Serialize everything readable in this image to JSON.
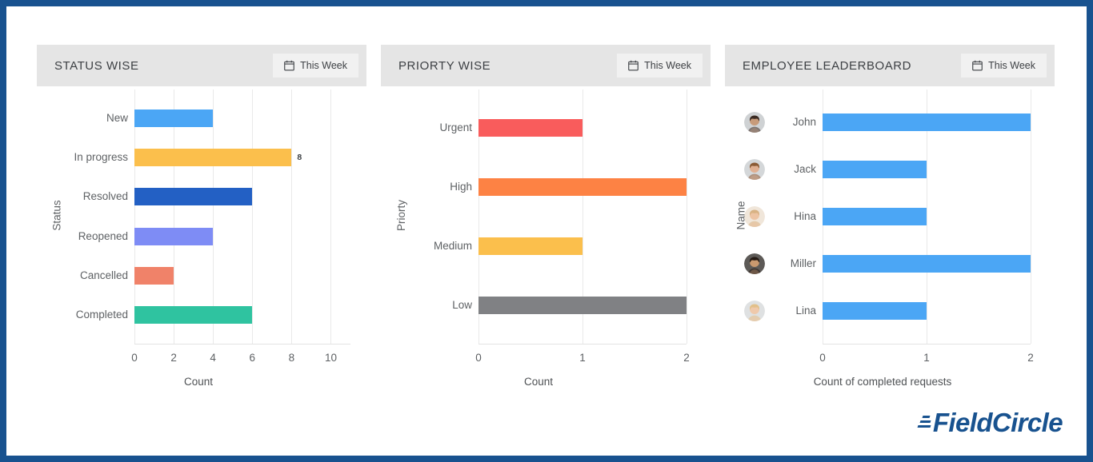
{
  "theme": {
    "border_color": "#18528f",
    "panel_header_bg": "#e5e5e5",
    "button_bg": "#f1f1f1",
    "page_bg": "#ffffff",
    "grid_color": "#e9e9e9",
    "brand_color": "#18528f"
  },
  "panels": [
    {
      "title": "STATUS WISE",
      "button": {
        "label": "This Week",
        "icon": "calendar-icon"
      }
    },
    {
      "title": "PRIORTY WISE",
      "button": {
        "label": "This Week",
        "icon": "calendar-icon"
      }
    },
    {
      "title": "EMPLOYEE LEADERBOARD",
      "button": {
        "label": "This Week",
        "icon": "calendar-icon"
      }
    }
  ],
  "logo": {
    "text": "FieldCircle",
    "icon": "speed-lines-icon"
  },
  "chart_data": [
    {
      "type": "bar",
      "orientation": "horizontal",
      "title": "STATUS WISE",
      "xlabel": "Count",
      "ylabel": "Status",
      "categories": [
        "New",
        "In progress",
        "Resolved",
        "Reopened",
        "Cancelled",
        "Completed"
      ],
      "values": [
        4,
        8,
        6,
        4,
        2,
        6
      ],
      "colors": [
        "#4ba6f5",
        "#fbbf4c",
        "#2360c4",
        "#7e8cf5",
        "#f08269",
        "#2fc3a0"
      ],
      "data_labels": [
        "",
        "8",
        "",
        "",
        "",
        ""
      ],
      "xlim": [
        0,
        11
      ],
      "xticks": [
        0,
        2,
        4,
        6,
        8,
        10
      ],
      "xtick_labels": [
        "0",
        "2",
        "4",
        "6",
        "8",
        "10"
      ],
      "grid": true,
      "legend": "none"
    },
    {
      "type": "bar",
      "orientation": "horizontal",
      "title": "PRIORTY WISE",
      "xlabel": "Count",
      "ylabel": "Priorty",
      "categories": [
        "Urgent",
        "High",
        "Medium",
        "Low"
      ],
      "values": [
        1,
        2,
        1,
        2
      ],
      "colors": [
        "#f95c5c",
        "#fd8244",
        "#fbbf4c",
        "#808184"
      ],
      "data_labels": [
        "",
        "",
        "",
        ""
      ],
      "xlim": [
        0,
        2
      ],
      "xticks": [
        0,
        1,
        2
      ],
      "xtick_labels": [
        "0",
        "1",
        "2"
      ],
      "grid": true,
      "legend": "none"
    },
    {
      "type": "bar",
      "orientation": "horizontal",
      "title": "EMPLOYEE LEADERBOARD",
      "xlabel": "Count of completed requests",
      "ylabel": "Name",
      "categories": [
        "John",
        "Jack",
        "Hina",
        "Miller",
        "Lina"
      ],
      "values": [
        2,
        1,
        1,
        2,
        1
      ],
      "colors": [
        "#4ba6f5",
        "#4ba6f5",
        "#4ba6f5",
        "#4ba6f5",
        "#4ba6f5"
      ],
      "data_labels": [
        "",
        "",
        "",
        "",
        ""
      ],
      "avatars": [
        {
          "name": "John",
          "icon": "avatar-john",
          "skin": "#c79b7a",
          "hair": "#3a2a22",
          "bg": "#cfd2d4"
        },
        {
          "name": "Jack",
          "icon": "avatar-jack",
          "skin": "#e0b092",
          "hair": "#8a5a34",
          "bg": "#d4d7d9"
        },
        {
          "name": "Hina",
          "icon": "avatar-hina",
          "skin": "#edc4a3",
          "hair": "#d8b283",
          "bg": "#f0e6da"
        },
        {
          "name": "Miller",
          "icon": "avatar-miller",
          "skin": "#c9996f",
          "hair": "#241a14",
          "bg": "#5d5a57"
        },
        {
          "name": "Lina",
          "icon": "avatar-lina",
          "skin": "#efc9ab",
          "hair": "#e2c089",
          "bg": "#dfe1e2"
        }
      ],
      "xlim": [
        0,
        2
      ],
      "xticks": [
        0,
        1,
        2
      ],
      "xtick_labels": [
        "0",
        "1",
        "2"
      ],
      "grid": true,
      "legend": "none"
    }
  ]
}
